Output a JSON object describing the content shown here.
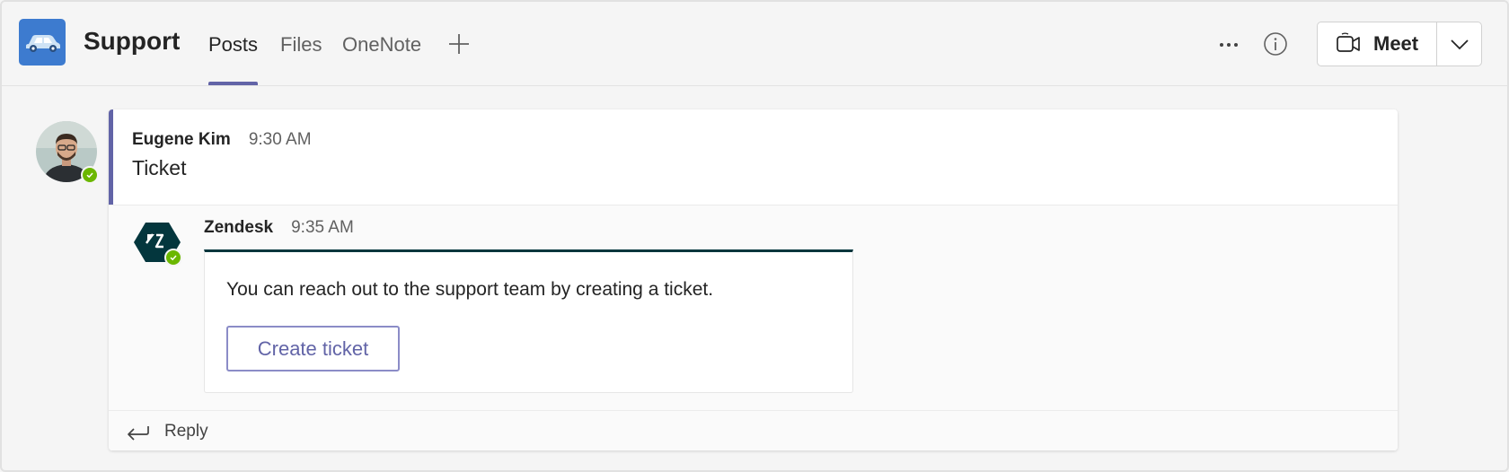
{
  "header": {
    "team_name": "Support",
    "tabs": [
      {
        "label": "Posts",
        "active": true
      },
      {
        "label": "Files",
        "active": false
      },
      {
        "label": "OneNote",
        "active": false
      }
    ],
    "add_tab_icon": "plus-icon",
    "more_icon": "more-icon",
    "info_icon": "info-icon",
    "meet_label": "Meet",
    "meet_icon": "video-camera-icon",
    "meet_dropdown_icon": "chevron-down-icon"
  },
  "post": {
    "author": "Eugene Kim",
    "time": "9:30 AM",
    "body": "Ticket",
    "presence": "available"
  },
  "bot_reply": {
    "author": "Zendesk",
    "time": "9:35 AM",
    "card_text": "You can reach out to the support team by creating a ticket.",
    "button_label": "Create ticket"
  },
  "reply_label": "Reply",
  "colors": {
    "accent": "#6264a7",
    "team_logo": "#3d7bcf",
    "presence_available": "#6bb700",
    "zendesk": "#03363d"
  }
}
